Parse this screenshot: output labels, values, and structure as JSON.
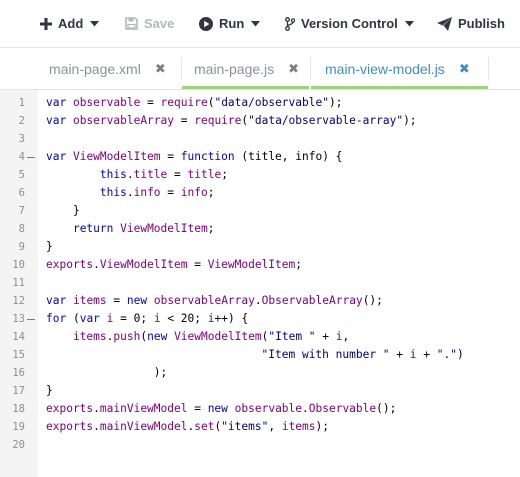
{
  "toolbar": {
    "add": "Add",
    "save": "Save",
    "run": "Run",
    "version_control": "Version Control",
    "publish": "Publish"
  },
  "tabs": [
    {
      "label": "main-page.xml",
      "close": "✖"
    },
    {
      "label": "main-page.js",
      "close": "✖"
    },
    {
      "label": "main-view-model.js",
      "close": "✖"
    }
  ],
  "colors": {
    "active_tab": "#3d8fbf",
    "tab_underline_js": "#9fd27f",
    "keyword": "#0000cd",
    "identifier": "#800080",
    "string": "#000080"
  },
  "editor": {
    "line_numbers": [
      "1",
      "2",
      "3",
      "4",
      "5",
      "6",
      "7",
      "8",
      "9",
      "10",
      "11",
      "12",
      "13",
      "14",
      "15",
      "16",
      "17",
      "18",
      "19",
      "20"
    ],
    "fold_lines": [
      "4",
      "13"
    ],
    "lines": [
      [
        {
          "t": "var",
          "c": "kw"
        },
        {
          "t": " ",
          "c": "pl"
        },
        {
          "t": "observable",
          "c": "id"
        },
        {
          "t": " = ",
          "c": "pl"
        },
        {
          "t": "require",
          "c": "id"
        },
        {
          "t": "(",
          "c": "pl"
        },
        {
          "t": "\"data/observable\"",
          "c": "st"
        },
        {
          "t": ");",
          "c": "pl"
        }
      ],
      [
        {
          "t": "var",
          "c": "kw"
        },
        {
          "t": " ",
          "c": "pl"
        },
        {
          "t": "observableArray",
          "c": "id"
        },
        {
          "t": " = ",
          "c": "pl"
        },
        {
          "t": "require",
          "c": "id"
        },
        {
          "t": "(",
          "c": "pl"
        },
        {
          "t": "\"data/observable-array\"",
          "c": "st"
        },
        {
          "t": ");",
          "c": "pl"
        }
      ],
      [],
      [
        {
          "t": "var",
          "c": "kw"
        },
        {
          "t": " ",
          "c": "pl"
        },
        {
          "t": "ViewModelItem",
          "c": "id"
        },
        {
          "t": " = ",
          "c": "pl"
        },
        {
          "t": "function",
          "c": "kw"
        },
        {
          "t": " (title, info) {",
          "c": "pl"
        }
      ],
      [
        {
          "t": "        ",
          "c": "pl"
        },
        {
          "t": "this",
          "c": "kw"
        },
        {
          "t": ".",
          "c": "pl"
        },
        {
          "t": "title",
          "c": "id"
        },
        {
          "t": " = ",
          "c": "pl"
        },
        {
          "t": "title",
          "c": "id"
        },
        {
          "t": ";",
          "c": "pl"
        }
      ],
      [
        {
          "t": "        ",
          "c": "pl"
        },
        {
          "t": "this",
          "c": "kw"
        },
        {
          "t": ".",
          "c": "pl"
        },
        {
          "t": "info",
          "c": "id"
        },
        {
          "t": " = ",
          "c": "pl"
        },
        {
          "t": "info",
          "c": "id"
        },
        {
          "t": ";",
          "c": "pl"
        }
      ],
      [
        {
          "t": "    }",
          "c": "pl"
        }
      ],
      [
        {
          "t": "    ",
          "c": "pl"
        },
        {
          "t": "return",
          "c": "kw"
        },
        {
          "t": " ",
          "c": "pl"
        },
        {
          "t": "ViewModelItem",
          "c": "id"
        },
        {
          "t": ";",
          "c": "pl"
        }
      ],
      [
        {
          "t": "}",
          "c": "pl"
        }
      ],
      [
        {
          "t": "exports",
          "c": "id"
        },
        {
          "t": ".",
          "c": "pl"
        },
        {
          "t": "ViewModelItem",
          "c": "id"
        },
        {
          "t": " = ",
          "c": "pl"
        },
        {
          "t": "ViewModelItem",
          "c": "id"
        },
        {
          "t": ";",
          "c": "pl"
        }
      ],
      [],
      [
        {
          "t": "var",
          "c": "kw"
        },
        {
          "t": " ",
          "c": "pl"
        },
        {
          "t": "items",
          "c": "id"
        },
        {
          "t": " = ",
          "c": "pl"
        },
        {
          "t": "new",
          "c": "kw"
        },
        {
          "t": " ",
          "c": "pl"
        },
        {
          "t": "observableArray",
          "c": "id"
        },
        {
          "t": ".",
          "c": "pl"
        },
        {
          "t": "ObservableArray",
          "c": "id"
        },
        {
          "t": "();",
          "c": "pl"
        }
      ],
      [
        {
          "t": "for",
          "c": "kw"
        },
        {
          "t": " (",
          "c": "pl"
        },
        {
          "t": "var",
          "c": "kw"
        },
        {
          "t": " ",
          "c": "pl"
        },
        {
          "t": "i",
          "c": "id"
        },
        {
          "t": " = 0; ",
          "c": "pl"
        },
        {
          "t": "i",
          "c": "id"
        },
        {
          "t": " < 20; ",
          "c": "pl"
        },
        {
          "t": "i",
          "c": "id"
        },
        {
          "t": "++) {",
          "c": "pl"
        }
      ],
      [
        {
          "t": "    ",
          "c": "pl"
        },
        {
          "t": "items",
          "c": "id"
        },
        {
          "t": ".",
          "c": "pl"
        },
        {
          "t": "push",
          "c": "id"
        },
        {
          "t": "(",
          "c": "pl"
        },
        {
          "t": "new",
          "c": "kw"
        },
        {
          "t": " ",
          "c": "pl"
        },
        {
          "t": "ViewModelItem",
          "c": "id"
        },
        {
          "t": "(",
          "c": "pl"
        },
        {
          "t": "\"Item \"",
          "c": "st"
        },
        {
          "t": " + ",
          "c": "pl"
        },
        {
          "t": "i",
          "c": "id"
        },
        {
          "t": ",",
          "c": "pl"
        }
      ],
      [
        {
          "t": "                                ",
          "c": "pl"
        },
        {
          "t": "\"Item with number \"",
          "c": "st"
        },
        {
          "t": " + ",
          "c": "pl"
        },
        {
          "t": "i",
          "c": "id"
        },
        {
          "t": " + ",
          "c": "pl"
        },
        {
          "t": "\".\"",
          "c": "st"
        },
        {
          "t": ")",
          "c": "pl"
        }
      ],
      [
        {
          "t": "                );",
          "c": "pl"
        }
      ],
      [
        {
          "t": "}",
          "c": "pl"
        }
      ],
      [
        {
          "t": "exports",
          "c": "id"
        },
        {
          "t": ".",
          "c": "pl"
        },
        {
          "t": "mainViewModel",
          "c": "id"
        },
        {
          "t": " = ",
          "c": "pl"
        },
        {
          "t": "new",
          "c": "kw"
        },
        {
          "t": " ",
          "c": "pl"
        },
        {
          "t": "observable",
          "c": "id"
        },
        {
          "t": ".",
          "c": "pl"
        },
        {
          "t": "Observable",
          "c": "id"
        },
        {
          "t": "();",
          "c": "pl"
        }
      ],
      [
        {
          "t": "exports",
          "c": "id"
        },
        {
          "t": ".",
          "c": "pl"
        },
        {
          "t": "mainViewModel",
          "c": "id"
        },
        {
          "t": ".",
          "c": "pl"
        },
        {
          "t": "set",
          "c": "id"
        },
        {
          "t": "(",
          "c": "pl"
        },
        {
          "t": "\"items\"",
          "c": "st"
        },
        {
          "t": ", ",
          "c": "pl"
        },
        {
          "t": "items",
          "c": "id"
        },
        {
          "t": ");",
          "c": "pl"
        }
      ],
      []
    ]
  }
}
